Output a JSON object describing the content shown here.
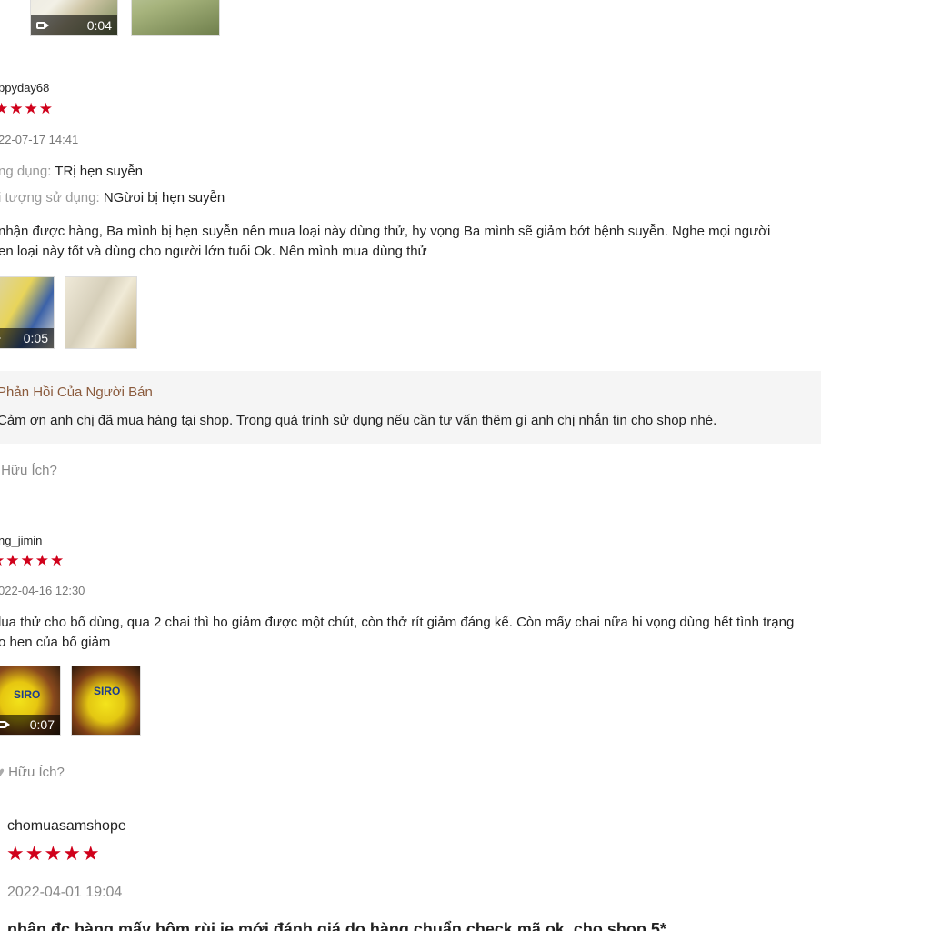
{
  "top_media": {
    "video_duration": "0:04"
  },
  "reviews": [
    {
      "username": "ppyday68",
      "stars": "★★★★",
      "time": "22-07-17 14:41",
      "props": [
        {
          "label": "ng dụng:",
          "value": "TRị hẹn suyễn"
        },
        {
          "label": "i tượng sử dụng:",
          "value": "NGừoi bị hẹn suyễn"
        }
      ],
      "body_line1": "nhận được hàng, Ba mình bị hẹn suyễn nên mua loại này dùng thử, hy vọng Ba mình sẽ giảm bớt bệnh suyễn. Nghe mọi người",
      "body_line2": "en loại này tốt và dùng cho người lớn tuổi Ok. Nên mình mua dùng thử",
      "video_duration": "0:05",
      "seller_title": "Phản Hồi Của Người Bán",
      "seller_text": "Cảm ơn anh chị đã mua hàng tại shop. Trong quá trình sử dụng nếu cần tư vấn thêm gì anh chị nhắn tin cho shop nhé.",
      "helpful": "Hữu Ích?"
    },
    {
      "username": "ng_jimin",
      "stars": "★★★★★",
      "time": "022-04-16 12:30",
      "body_line1": "lua thử cho bố dùng, qua 2 chai thì ho giảm được một chút, còn thở rít giảm đáng kể. Còn mấy chai nữa hi vọng dùng hết tình trạng",
      "body_line2": "o hen của bố giảm",
      "video_duration": "0:07",
      "helpful": "Hữu Ích?"
    },
    {
      "username": "chomuasamshope",
      "stars": "★★★★★",
      "time": "2022-04-01 19:04",
      "body_line1": "nhận đc hàng mấy hôm rùi ie mới đánh giá do hàng chuẩn check mã ok, cho shop 5*"
    }
  ],
  "colors": {
    "star": "#d0011b",
    "seller_title": "#8a5a3c"
  }
}
